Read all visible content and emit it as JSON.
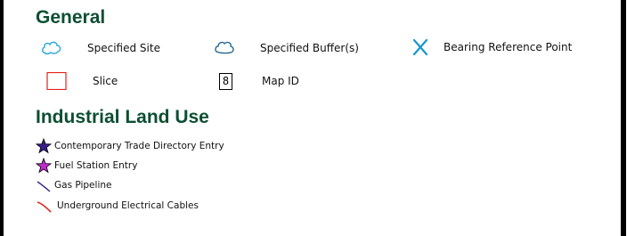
{
  "general": {
    "title": "General",
    "specified_site": "Specified Site",
    "specified_buffers": "Specified Buffer(s)",
    "bearing_reference": "Bearing Reference Point",
    "slice": "Slice",
    "map_id_symbol": "8",
    "map_id": "Map ID"
  },
  "industrial": {
    "title": "Industrial Land Use",
    "items": [
      "Contemporary Trade Directory Entry",
      "Fuel Station Entry",
      "Gas Pipeline",
      "Underground Electrical Cables"
    ]
  },
  "colors": {
    "heading": "#0d4f33",
    "site_outline": "#2aa6d6",
    "buffer_outline": "#1a5f8a",
    "bearing_x": "#1697c9",
    "slice_outline": "#e2231a",
    "trade_star_fill": "#3a1d8c",
    "fuel_star_fill": "#c02bd0",
    "gas_line": "#2b2a8f",
    "electric_line": "#e2231a"
  },
  "icons": {
    "site": "cloud-outline-icon",
    "buffer": "cloud-outline-icon",
    "bearing": "x-icon",
    "slice": "square-outline-icon",
    "map_id": "boxed-digit-icon",
    "trade": "star-icon",
    "fuel": "star-icon",
    "gas": "line-icon",
    "electric": "line-icon"
  }
}
